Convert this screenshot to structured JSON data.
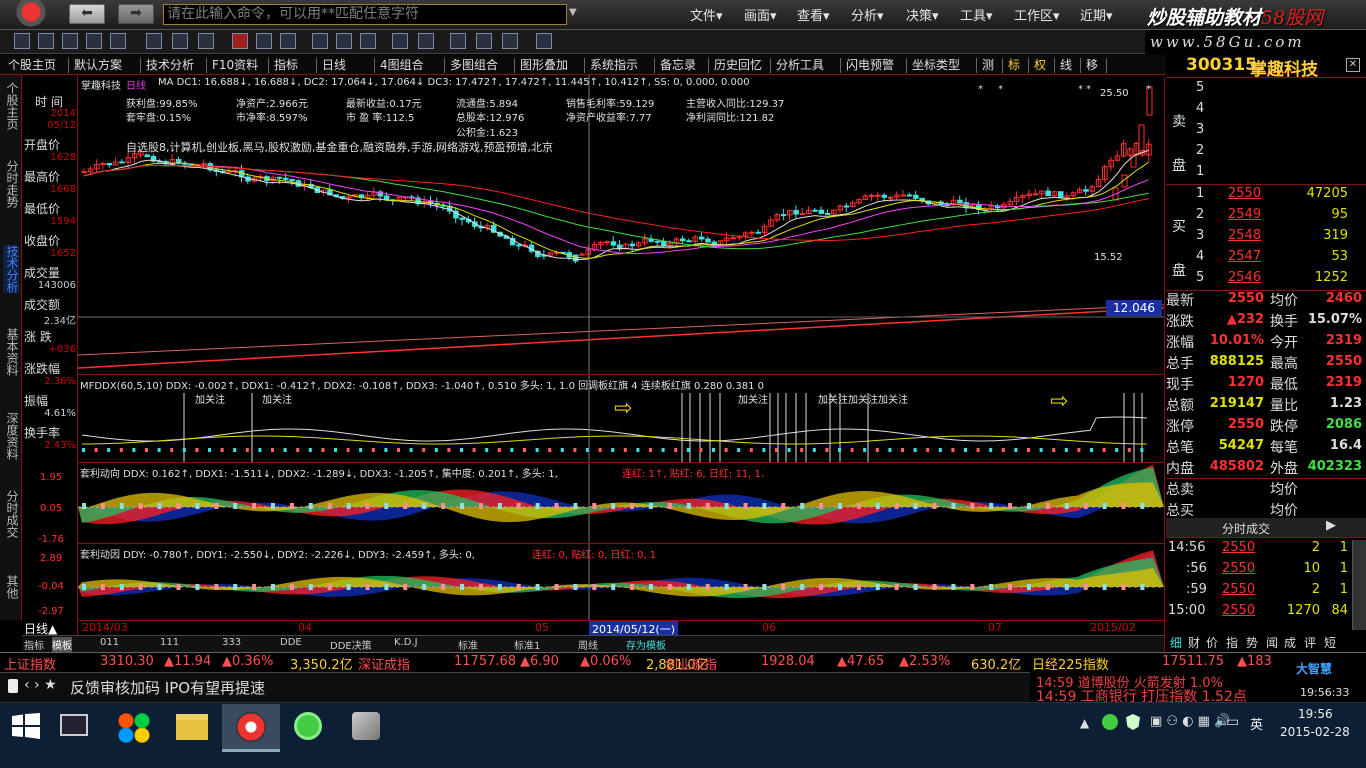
{
  "titlebar": {
    "command_placeholder": "请在此输入命令，可以用**匹配任意字符",
    "menu": [
      "文件▾",
      "画面▾",
      "查看▾",
      "分析▾",
      "决策▾",
      "工具▾",
      "工作区▾",
      "近期▾"
    ],
    "watermark_prefix": "炒股辅助教材",
    "watermark_brand": "58股网",
    "watermark_url": "www.58Gu.com"
  },
  "tabs": [
    "个股主页",
    "默认方案",
    "技术分析",
    "F10资料",
    "指标",
    "日线",
    "4图组合",
    "多图组合",
    "图形叠加",
    "系统指示",
    "备忘录",
    "历史回忆",
    "分析工具",
    "闪电预警",
    "坐标类型",
    "测",
    "标",
    "权",
    "线",
    "移"
  ],
  "stock": {
    "code": "300315",
    "name": "掌趣科技"
  },
  "left_side": [
    "个股主页",
    "分时走势",
    "技术分析",
    "基本资料",
    "深度资料",
    "分时成交",
    "其他"
  ],
  "info": {
    "labels": [
      "时 间",
      "开盘价",
      "最高价",
      "最低价",
      "收盘价",
      "成交量",
      "成交额",
      "涨 跌",
      "涨跌幅",
      "振幅",
      "换手率"
    ],
    "values": [
      "2014",
      "05/12",
      "1628",
      "1668",
      "1594",
      "1652",
      "143006",
      "2.34亿",
      "+036",
      "2.36%",
      "4.61%",
      "2.43%"
    ]
  },
  "chart_header": {
    "name": "掌趣科技",
    "period": "日线",
    "ma": "MA DC1: 16.688↓, 16.688↓, DC2: 17.064↓, 17.064↓ DC3: 17.472↑, 17.472↑, 11.445↑, 10.412↑, SS: 0, 0.000, 0.000"
  },
  "fundamentals": [
    "获利盘:99.85%",
    "净资产:2.966元",
    "最新收益:0.17元",
    "流通盘:5.894",
    "销售毛利率:59.129",
    "主营收入同比:129.37",
    "套牢盘:0.15%",
    "市净率:8.597%",
    "市 盈 率:112.5",
    "总股本:12.976",
    "净资产收益率:7.77",
    "净利润同比:121.82",
    "公积金:1.623"
  ],
  "concepts": "自选股8,计算机,创业板,黑马,股权激励,基金重仓,融资融券,手游,网络游戏,预盈预增,北京",
  "price_labels": {
    "high": "25.50",
    "low": "15.52",
    "level": "12.046"
  },
  "ddx_panel": {
    "header": "MFDDX(60,5,10) DDX: -0.002↑, DDX1: -0.412↑, DDX2: -0.108↑, DDX3: -1.040↑, 0.510 多头: 1, 1.0 回调板红旗 4 连续板红旗 0.280 0.381 0",
    "tags": [
      "加关注",
      "加关注",
      "加关注",
      "加关注加关注加关注"
    ]
  },
  "panel2": {
    "header1": "套利动向 DDX: 0.162↑, DDX1: -1.511↓, DDX2: -1.289↓, DDX3: -1.205↑, 集中度: 0.201↑, 多头: 1,",
    "header2": "连红: 1↑, 贴红: 6, 日红: 11, 1.",
    "scale": [
      "1.95",
      "0.05",
      "-1.76"
    ]
  },
  "panel3": {
    "header1": "套利动因 DDY: -0.780↑, DDY1: -2.550↓, DDY2: -2.226↓, DDY3: -2.459↑, 多头: 0,",
    "header2": "连红: 0, 贴红: 0, 日红: 0, 1",
    "scale": [
      "2.89",
      "-0.04",
      "-2.97"
    ]
  },
  "xaxis": {
    "ticks": [
      "2014/03",
      "04",
      "05",
      "06",
      "07",
      "2015/02"
    ],
    "cursor": "2014/05/12(一)",
    "label": "日线▲"
  },
  "bottom_tabs": [
    "指标",
    "模板",
    "011",
    "111",
    "333",
    "DDE",
    "DDE决策",
    "K.D.J",
    "标准",
    "标准1",
    "周线",
    "存为模板"
  ],
  "order_book": {
    "sell_label": "卖\n盘",
    "sell": [
      "5",
      "4",
      "3",
      "2",
      "1"
    ],
    "buy_label": "买\n盘",
    "buy": [
      [
        "1",
        "2550",
        "47205"
      ],
      [
        "2",
        "2549",
        "95"
      ],
      [
        "3",
        "2548",
        "319"
      ],
      [
        "4",
        "2547",
        "53"
      ],
      [
        "5",
        "2546",
        "1252"
      ]
    ]
  },
  "quote": [
    [
      "最新",
      "2550",
      "均价",
      "2460"
    ],
    [
      "涨跌",
      "▲232",
      "换手",
      "15.07%"
    ],
    [
      "涨幅",
      "10.01%",
      "今开",
      "2319"
    ],
    [
      "总手",
      "888125",
      "最高",
      "2550"
    ],
    [
      "现手",
      "1270",
      "最低",
      "2319"
    ],
    [
      "总额",
      "219147",
      "量比",
      "1.23"
    ],
    [
      "涨停",
      "2550",
      "跌停",
      "2086"
    ],
    [
      "总笔",
      "54247",
      "每笔",
      "16.4"
    ],
    [
      "内盘",
      "485802",
      "外盘",
      "402323"
    ],
    [
      "总卖",
      "",
      "均价",
      ""
    ],
    [
      "总买",
      "",
      "均价",
      ""
    ]
  ],
  "ticks_title": "分时成交",
  "ticks": [
    [
      "14:56",
      "2550",
      "2",
      "1"
    ],
    [
      ":56",
      "2550",
      "10",
      "1"
    ],
    [
      ":59",
      "2550",
      "2",
      "1"
    ],
    [
      "15:00",
      "2550",
      "1270",
      "84"
    ]
  ],
  "right_tabs": [
    "细",
    "财",
    "价",
    "指",
    "势",
    "闻",
    "成",
    "评",
    "短"
  ],
  "ticker": [
    [
      "上证指数",
      "3310.30",
      "▲11.94",
      "▲0.36%",
      "3,350.2亿"
    ],
    [
      "深证成指",
      "11757.68",
      "▲6.90",
      "▲0.06%",
      "2,881.0亿"
    ],
    [
      "创业板指",
      "1928.04",
      "▲47.65",
      "▲2.53%",
      "630.2亿"
    ],
    [
      "日经225指数",
      "17511.75",
      "▲183",
      ""
    ]
  ],
  "news": {
    "headline": "反馈审核加码 IPO有望再提速",
    "alert1": "14:59 道博股份 火箭发射 1.0%",
    "alert2": "14:59 工商银行 打压指数 1.52点",
    "brand": "大智慧",
    "clock": "19:56:33"
  },
  "taskbar": {
    "time": "19:56",
    "date": "2015-02-28",
    "ime": "英"
  },
  "chart_data": {
    "type": "candlestick",
    "x": [
      "2014/03",
      "04",
      "05",
      "06",
      "07",
      "2015/02"
    ],
    "y_levels": {
      "high": 25.5,
      "low": 15.52,
      "line": 12.046
    },
    "cursor_date": "2014/05/12"
  }
}
